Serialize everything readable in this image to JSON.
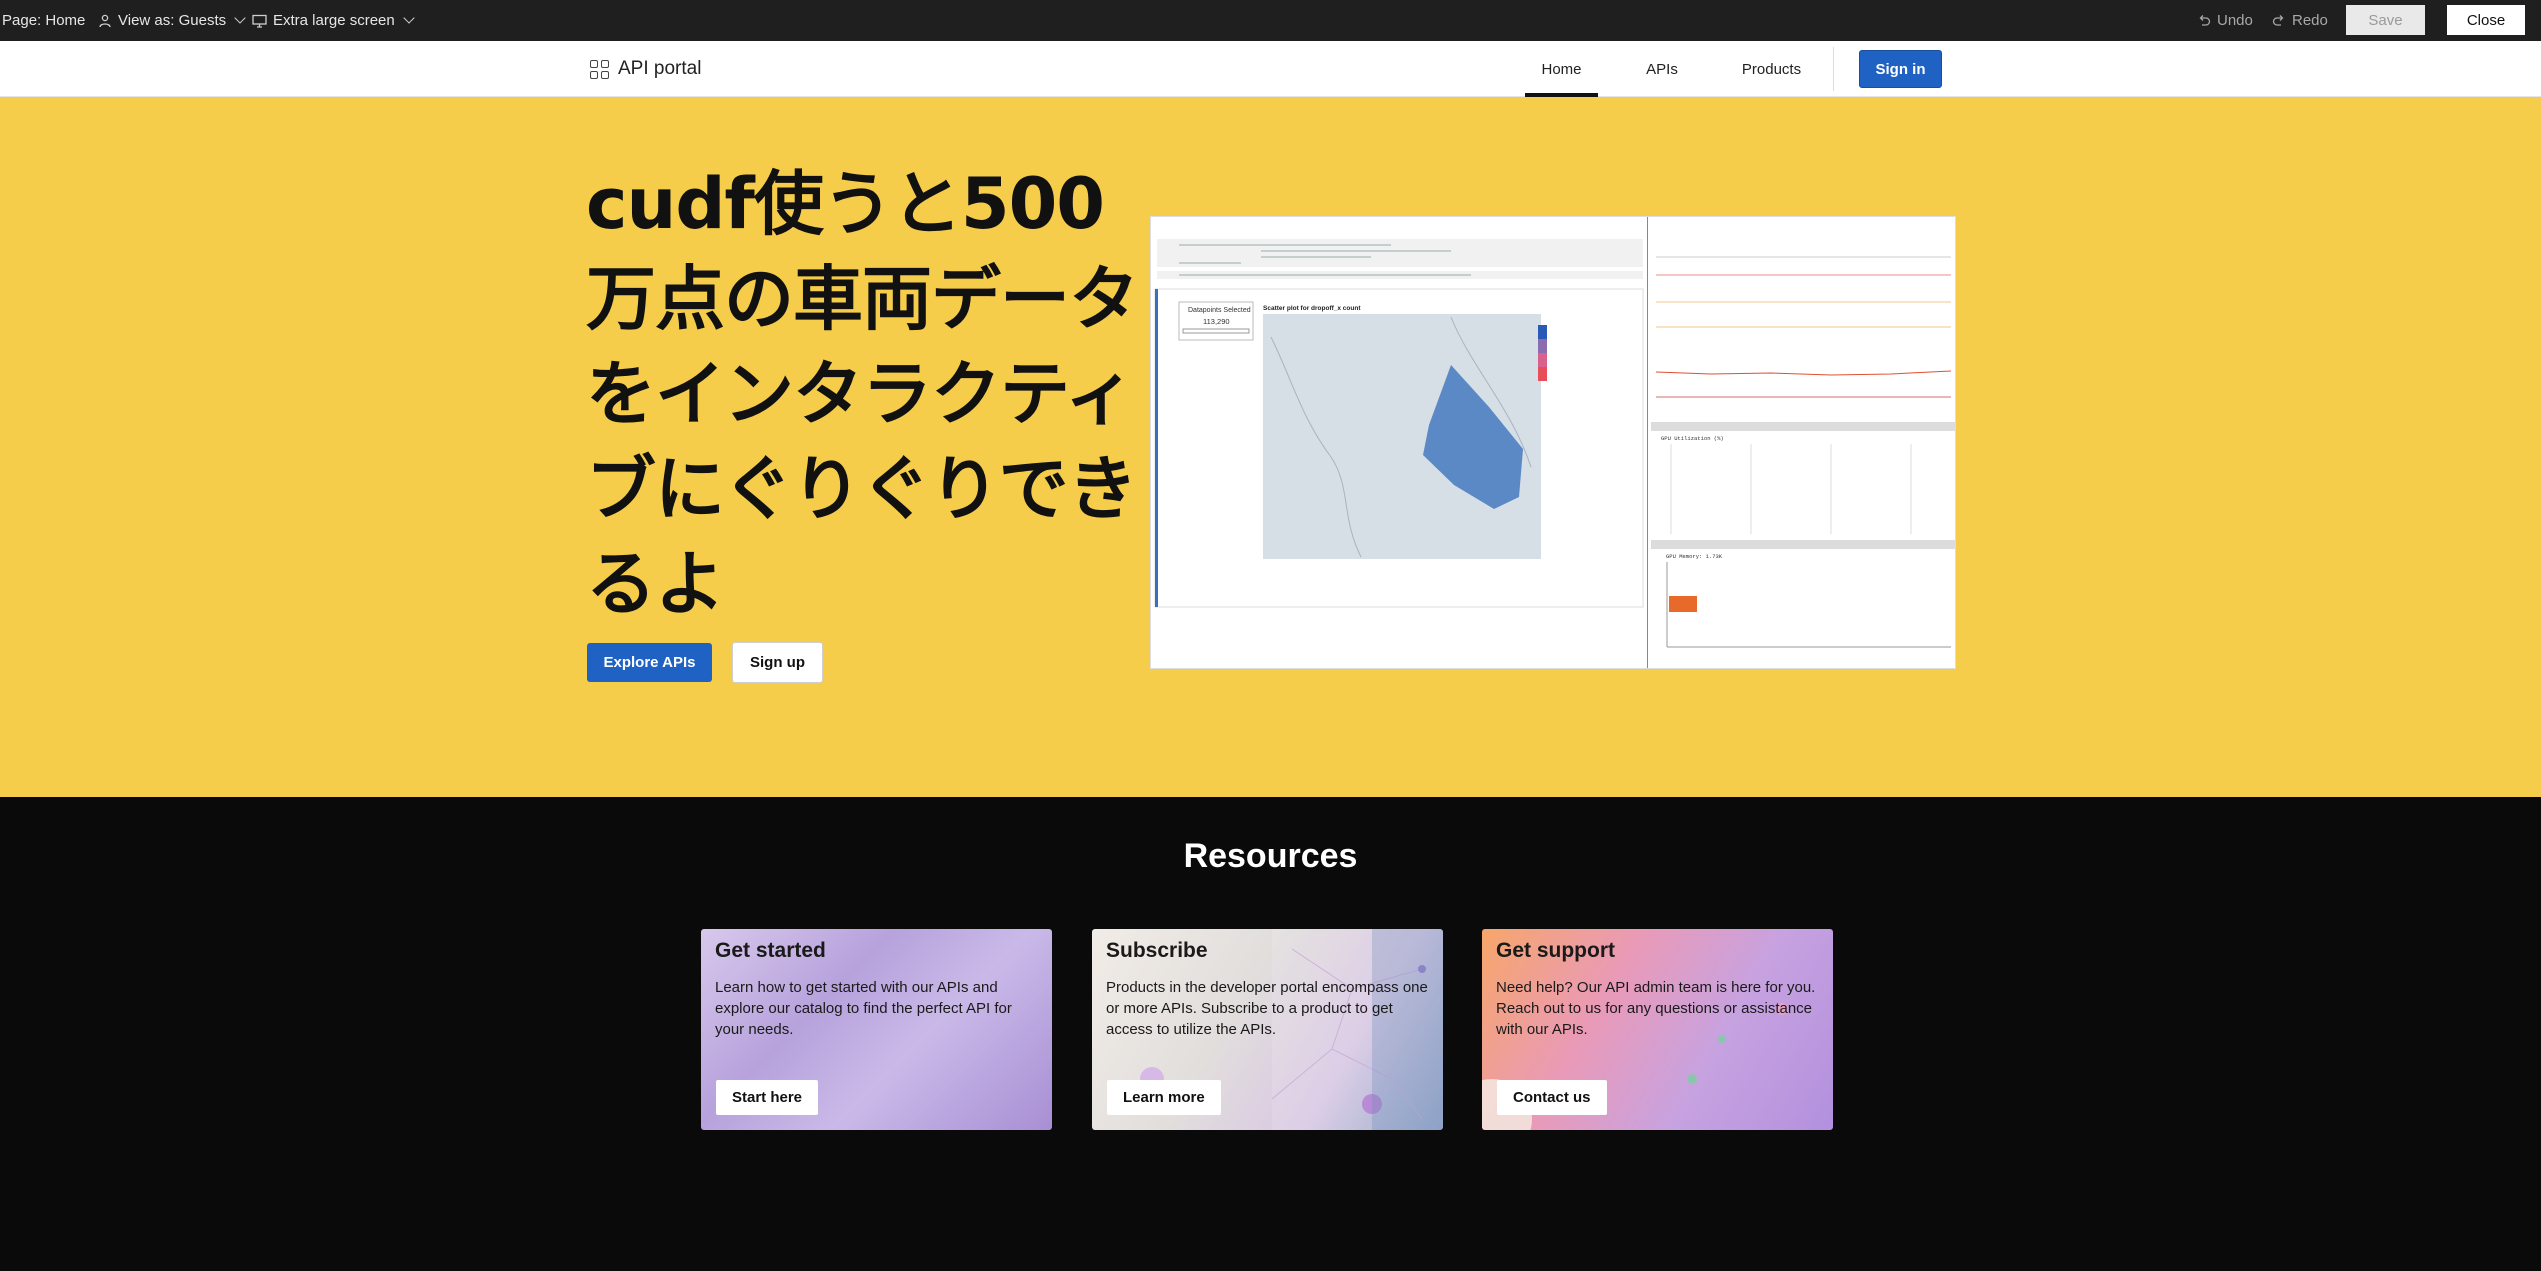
{
  "editor": {
    "page_label": "Page: Home",
    "view_as": "View as: Guests",
    "screen": "Extra large screen",
    "undo": "Undo",
    "redo": "Redo",
    "save": "Save",
    "close": "Close"
  },
  "nav": {
    "brand": "API portal",
    "links": [
      "Home",
      "APIs",
      "Products"
    ],
    "active": "Home",
    "sign_in": "Sign in"
  },
  "hero": {
    "title": "cudf使うと500万点の車両データをインタラクティブにぐりぐりできるよ",
    "explore_button": "Explore APIs",
    "signup_button": "Sign up",
    "background_color": "#f5cd4b",
    "screenshot": {
      "datapoints_label": "Datapoints Selected",
      "datapoints_value": "113,290",
      "plot_title": "Scatter plot for dropoff_x count",
      "panel_gpu_util": "GPU Utilization (%)",
      "panel_gpu_mem": "GPU Memory: 1.73K"
    }
  },
  "resources": {
    "title": "Resources",
    "cards": [
      {
        "title": "Get started",
        "text": "Learn how to get started with our APIs and explore our catalog to find the perfect API for your needs.",
        "button": "Start here"
      },
      {
        "title": "Subscribe",
        "text": "Products in the developer portal encompass one or more APIs. Subscribe to a product to get access to utilize the APIs.",
        "button": "Learn more"
      },
      {
        "title": "Get support",
        "text": "Need help? Our API admin team is here for you. Reach out to us for any questions or assistance with our APIs.",
        "button": "Contact us"
      }
    ]
  },
  "colors": {
    "primary": "#1f62c4",
    "editor_bar": "#1f1f1f",
    "footer_bg": "#0b0a0a"
  }
}
